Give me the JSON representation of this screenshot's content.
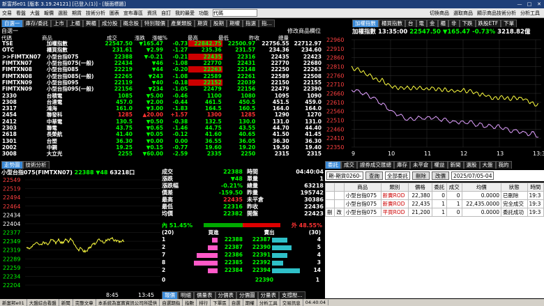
{
  "app": {
    "title": "新富邦e01 [版本 3.19.24121] [已登入(1)] - [版面標題]",
    "window_controls": [
      "—",
      "□",
      "✕"
    ]
  },
  "menu": {
    "items": [
      "交易",
      "看盤",
      "大盤",
      "報價",
      "選股",
      "期貨",
      "技術分析",
      "圖表",
      "宣布專區",
      "資訊",
      "自訂",
      "我的最愛",
      "功能"
    ],
    "search_value": "代碼",
    "right_items": [
      "切換商品",
      "選取商品",
      "顯示商品技術分析",
      "分析工具"
    ]
  },
  "quote": {
    "tabs": [
      "自選一",
      "庫存/委託",
      "上市",
      "上櫃",
      "興櫃",
      "成分股",
      "概念股",
      "特別報價",
      "產業類股",
      "期貨",
      "股期",
      "期權",
      "指選",
      "指..."
    ],
    "header_left": "自選一",
    "header_right": "修改商品欄位",
    "columns": [
      "代碼",
      "商品",
      "成交",
      "漲跌",
      "漲幅%",
      "最高",
      "最低",
      "昨收",
      "總量"
    ],
    "rows": [
      [
        "TSE",
        "加權指數",
        "22547.50",
        "▼165.47",
        "-0.73",
        "22842.75",
        "22500.97",
        "22756.55",
        "22712.97"
      ],
      [
        "OTC",
        "櫃買指數",
        "231.61",
        "▼2.99",
        "-1.27",
        "235.36",
        "231.57",
        "234.36",
        "234.60"
      ],
      [
        ">>FIMTXN07",
        "小型台指075",
        "22388",
        "▼-0.21",
        "-0.21",
        "22435",
        "22316",
        "22435",
        "22423"
      ],
      [
        "FIMTXN07",
        "小型台指075(一般)",
        "22434",
        "▼46",
        "-1.08",
        "22770",
        "22431",
        "22770",
        "22680"
      ],
      [
        "FIMTXN08",
        "小型台指085",
        "22219",
        "▼44",
        "-0.20",
        "22263",
        "22148",
        "22250",
        "22263"
      ],
      [
        "FIMTXN08",
        "小型台指085(一般)",
        "22265",
        "▼243",
        "-1.08",
        "22589",
        "22261",
        "22589",
        "22508"
      ],
      [
        "FIMTXN09",
        "小型台指095",
        "22119",
        "▼40",
        "-0.18",
        "22152",
        "22039",
        "22150",
        "22155"
      ],
      [
        "FIMTXN09",
        "小型台指095(一般)",
        "22156",
        "▼234",
        "-1.05",
        "22479",
        "22156",
        "22479",
        "22390"
      ],
      [
        "2330",
        "台積電",
        "1085",
        "▼5.00",
        "-0.46",
        "1100",
        "1080",
        "1095",
        "1090"
      ],
      [
        "2308",
        "台達電",
        "457.0",
        "▼2.00",
        "-0.44",
        "461.5",
        "450.5",
        "451.5",
        "459.0"
      ],
      [
        "2317",
        "鴻海",
        "161.0",
        "▼3.00",
        "-1.83",
        "164.5",
        "160.5",
        "164.0",
        "164.0"
      ],
      [
        "2454",
        "聯發科",
        "1285",
        "▲20.00",
        "+1.57",
        "1300",
        "1285",
        "1290",
        "1270"
      ],
      [
        "2412",
        "中華電",
        "130.5",
        "▼0.50",
        "-0.38",
        "132.5",
        "130.0",
        "131.0",
        "131.0"
      ],
      [
        "2303",
        "聯電",
        "43.75",
        "▼0.65",
        "-1.46",
        "44.75",
        "43.55",
        "44.70",
        "44.40"
      ],
      [
        "2618",
        "長榮航",
        "41.40",
        "▼0.05",
        "-0.12",
        "41.60",
        "40.65",
        "41.50",
        "41.45"
      ],
      [
        "1301",
        "台塑",
        "36.30",
        "▼0.00",
        "0.00",
        "36.55",
        "36.05",
        "36.30",
        "36.30"
      ],
      [
        "2002",
        "中鋼",
        "19.25",
        "▼0.15",
        "-0.77",
        "19.60",
        "19.20",
        "19.50",
        "19.40"
      ],
      [
        "3008",
        "大立光",
        "2255",
        "▼60.00",
        "-2.59",
        "2335",
        "2250",
        "2315",
        "2315"
      ]
    ]
  },
  "index_chart": {
    "tabs": [
      "加權指數",
      "櫃買指數",
      "台",
      "電",
      "金",
      "櫃",
      "非",
      "下跌",
      "跌股ETF",
      "下單"
    ],
    "name": "加權指數",
    "time": "13:35:00",
    "price": "22547.50",
    "change": "▼165.47",
    "pct": "-0.73%",
    "amount": "3218.82億",
    "y_ticks": [
      "22960",
      "22910",
      "22860",
      "22810",
      "22760",
      "22710",
      "22660",
      "22610",
      "22560",
      "22510",
      "22460",
      "22410",
      "22350"
    ],
    "x_ticks": [
      "9",
      "10",
      "11",
      "12",
      "13",
      "13:30"
    ]
  },
  "tick_chart": {
    "tabs": [
      "走勢圖",
      "技術分析"
    ],
    "name": "小型台指075(FIMTXN07)",
    "price": "22388",
    "change": "▼48",
    "volume": "63218",
    "unit": "口",
    "y_ticks": [
      "22549",
      "22519",
      "22494",
      "22464",
      "22434",
      "22404",
      "22377",
      "22349",
      "22319",
      "22289",
      "22259",
      "22234",
      "22204"
    ],
    "x_label": "8:45",
    "x_label2": "13:45"
  },
  "detail": {
    "rows": [
      [
        "成交",
        "22388",
        "時間",
        "04:40:04"
      ],
      [
        "漲跌",
        "▼48",
        "單量",
        "1"
      ],
      [
        "漲跌幅",
        "-0.21%",
        "總量",
        "63218"
      ],
      [
        "價差",
        "-159.50",
        "昨量",
        "195742"
      ],
      [
        "最高",
        "22435",
        "未平倉",
        "30386"
      ],
      [
        "最低",
        "22316",
        "昨收",
        "22436"
      ],
      [
        "均價",
        "22382",
        "開盤",
        "22423"
      ]
    ],
    "inner": "內 51.45%",
    "outer": "外 48.55%"
  },
  "depth": {
    "header": [
      "(20)",
      "買進",
      "賣出",
      "(30)"
    ],
    "rows": [
      {
        "bq": "1",
        "bp": "22388",
        "sp": "22387",
        "sq": "4",
        "bw": 8,
        "sw": 22
      },
      {
        "bq": "2",
        "bp": "22387",
        "sp": "22390",
        "sq": "5",
        "bw": 14,
        "sw": 28
      },
      {
        "bq": "7",
        "bp": "22386",
        "sp": "22391",
        "sq": "4",
        "bw": 30,
        "sw": 22
      },
      {
        "bq": "8",
        "bp": "22385",
        "sp": "22392",
        "sq": "3",
        "bw": 34,
        "sw": 16
      },
      {
        "bq": "2",
        "bp": "22384",
        "sp": "22394",
        "sq": "14",
        "bw": 14,
        "sw": 40
      }
    ],
    "total_b": "0",
    "total_mid": "22390",
    "total_s": "1"
  },
  "bottom_tabs": [
    "報價",
    "明細",
    "價量表",
    "分價表",
    "分價圖",
    "分量表",
    "支撐壓..."
  ],
  "orders": {
    "tabs": [
      "委託",
      "成交",
      "證券成交匯總",
      "庫存",
      "未平倉",
      "權益",
      "新聞",
      "選股",
      "大盤",
      "我的"
    ],
    "account": "期-期貨0260-",
    "query": "查詢",
    "filter": "全部委託",
    "delete": "刪除",
    "change": "改價",
    "date": "2025/07/05-04",
    "columns": [
      "",
      "",
      "商品",
      "類別",
      "價格",
      "委託",
      "成交",
      "均價",
      "狀態",
      "時間"
    ],
    "rows": [
      [
        "",
        "",
        "小型台指075",
        "新賣ROD",
        "22,380",
        "0",
        "0",
        "0.0000",
        "已刪除",
        "19:3"
      ],
      [
        "",
        "",
        "小型台指075",
        "新賣ROD",
        "22,435",
        "1",
        "1",
        "22,435.0000",
        "完全成交",
        "19:3"
      ],
      [
        "刪",
        "改",
        "小型台指075",
        "平買ROD",
        "21,200",
        "1",
        "0",
        "0.0000",
        "委託成功",
        "19:3"
      ]
    ]
  },
  "statusbar": {
    "items": [
      "新富邦e01",
      "大盤綜合看盤",
      "新聞",
      "完整文章",
      "本系統為富寶資訊公司所提供",
      "自選期指",
      "指數",
      "排行",
      "下單區",
      "自選",
      "期權",
      "分析工具",
      "交易訊息",
      "04:40:04"
    ]
  }
}
